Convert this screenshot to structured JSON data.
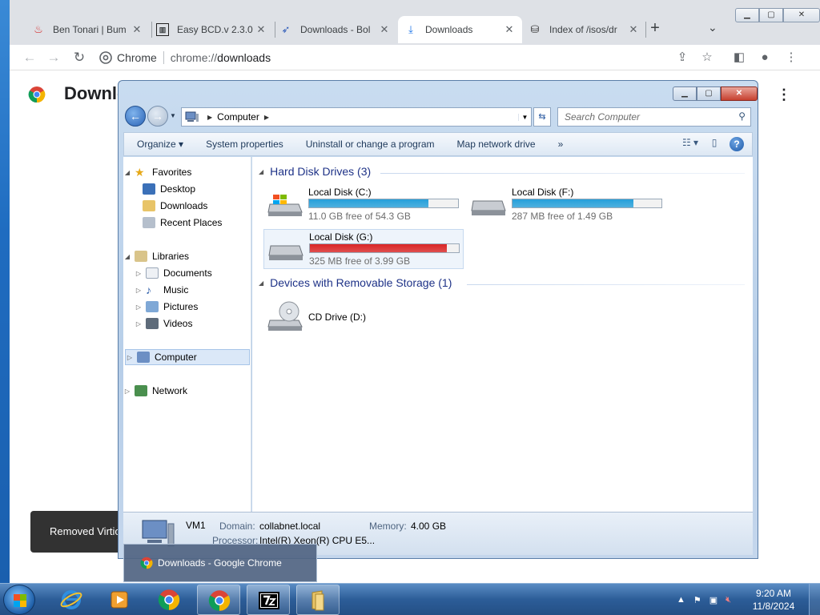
{
  "browser": {
    "tabs": [
      {
        "label": "Ben Tonari | Bum",
        "icon": "flame-icon"
      },
      {
        "label": "Easy BCD.v 2.3.0",
        "icon": "archive-icon"
      },
      {
        "label": "Downloads - Bol",
        "icon": "bird-icon"
      },
      {
        "label": "Downloads",
        "icon": "download-icon"
      },
      {
        "label": "Index of /isos/dr",
        "icon": "disk-icon"
      }
    ],
    "active_tab": 3,
    "omnibox": {
      "site": "Chrome",
      "url_prefix": "chrome://",
      "url_rest": "downloads"
    },
    "page_title": "Downlo",
    "toast": "Removed Virtio"
  },
  "explorer": {
    "address": "Computer",
    "search_placeholder": "Search Computer",
    "commands": [
      "Organize",
      "System properties",
      "Uninstall or change a program",
      "Map network drive",
      "»"
    ],
    "nav": {
      "favorites": "Favorites",
      "desktop": "Desktop",
      "downloads": "Downloads",
      "recent": "Recent Places",
      "libraries": "Libraries",
      "documents": "Documents",
      "music": "Music",
      "pictures": "Pictures",
      "videos": "Videos",
      "computer": "Computer",
      "network": "Network"
    },
    "groups": {
      "hdd": "Hard Disk Drives (3)",
      "removable": "Devices with Removable Storage (1)"
    },
    "drives": [
      {
        "name": "Local Disk (C:)",
        "free": "11.0 GB free of 54.3 GB",
        "used_fraction": 0.8,
        "color": "#26a0da"
      },
      {
        "name": "Local Disk (F:)",
        "free": "287 MB free of 1.49 GB",
        "used_fraction": 0.81,
        "color": "#26a0da"
      },
      {
        "name": "Local Disk (G:)",
        "free": "325 MB free of 3.99 GB",
        "used_fraction": 0.92,
        "color": "#da2626"
      }
    ],
    "cd_drive": "CD Drive (D:)",
    "details": {
      "name": "VM1",
      "domain_label": "Domain:",
      "domain": "collabnet.local",
      "memory_label": "Memory:",
      "memory": "4.00 GB",
      "processor_label": "Processor:",
      "processor": "Intel(R) Xeon(R) CPU E5..."
    }
  },
  "taskbar": {
    "thumbnail": "Downloads - Google Chrome",
    "time": "9:20 AM",
    "date": "11/8/2024"
  }
}
